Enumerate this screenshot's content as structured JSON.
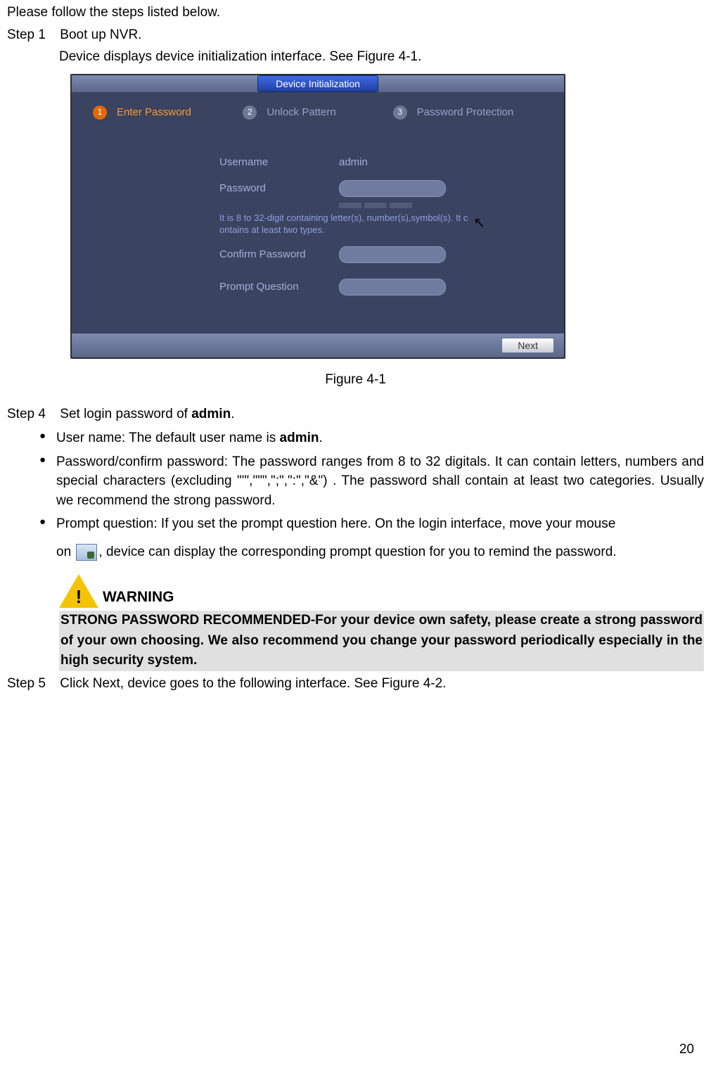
{
  "intro": "Please follow the steps listed below.",
  "step1": {
    "label": "Step 1",
    "text": "Boot up NVR."
  },
  "step1_sub": "Device displays device initialization interface. See Figure 4-1.",
  "ui": {
    "title": "Device Initialization",
    "steps": [
      {
        "num": "1",
        "label": "Enter Password",
        "active": true
      },
      {
        "num": "2",
        "label": "Unlock Pattern",
        "active": false
      },
      {
        "num": "3",
        "label": "Password Protection",
        "active": false
      }
    ],
    "username_label": "Username",
    "username_value": "admin",
    "password_label": "Password",
    "hint": "It is 8 to 32-digit containing letter(s), number(s),symbol(s). It c\nontains at least two types.",
    "confirm_label": "Confirm Password",
    "prompt_label": "Prompt Question",
    "next": "Next"
  },
  "caption": "Figure 4-1",
  "step4": {
    "label": "Step 4",
    "text_pre": "Set login password of ",
    "text_bold": "admin",
    "text_post": "."
  },
  "bullet1": {
    "pre": "User name: The default user name is ",
    "bold": "admin",
    "post": "."
  },
  "bullet2": "Password/confirm password: The password ranges from 8 to 32 digitals. It can contain letters, numbers and special characters (excluding \"'\",\"\"\",\";\",\":\",\"&\") . The password shall contain at least two categories. Usually we recommend the strong password.",
  "bullet3_a": "Prompt question: If you set the prompt question here. On the login interface, move your mouse",
  "bullet3_b": "on ",
  "bullet3_c": ", device can display the corresponding prompt question for you to remind the password.",
  "warning_label": "WARNING",
  "warning_body": "STRONG PASSWORD RECOMMENDED-For your device own safety, please create a strong password of your own choosing. We also recommend you change your password periodically especially in the high security system.",
  "step5": {
    "label": "Step 5",
    "text": "Click Next, device goes to the following interface. See Figure 4-2."
  },
  "page_number": "20"
}
